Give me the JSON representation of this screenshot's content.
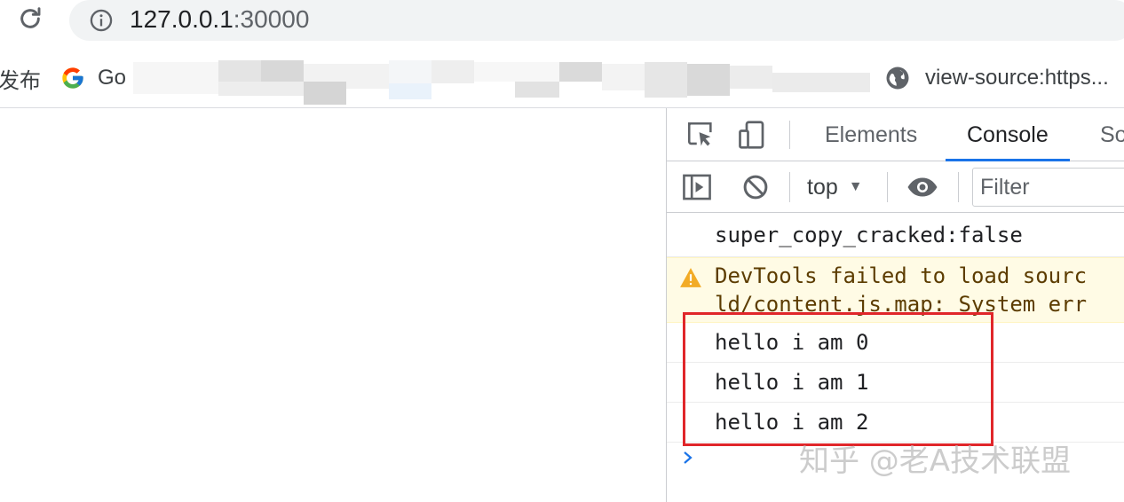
{
  "address_bar": {
    "url_host": "127.0.0.1",
    "url_port": ":30000"
  },
  "bookmarks": {
    "items": [
      {
        "label": "发布"
      },
      {
        "label": "Go"
      },
      {
        "label": "view-source:https..."
      }
    ]
  },
  "devtools": {
    "tabs": [
      {
        "label": "Elements"
      },
      {
        "label": "Console"
      },
      {
        "label": "So"
      }
    ],
    "active_tab": "Console",
    "context": "top",
    "filter_placeholder": "Filter",
    "messages": [
      {
        "text": "super_copy_cracked:false"
      },
      {
        "level": "warning",
        "line1": "DevTools failed to load sourc",
        "line2": "ld/content.js.map: System err"
      },
      {
        "text": "hello i am 0"
      },
      {
        "text": "hello i am 1"
      },
      {
        "text": "hello i am 2"
      }
    ]
  },
  "watermark": "知乎 @老A技术联盟",
  "colors": {
    "accent": "#1a73e8",
    "highlight_box": "#e0262a",
    "warning_bg": "#fffbe5",
    "warning_text": "#5c3c00"
  }
}
